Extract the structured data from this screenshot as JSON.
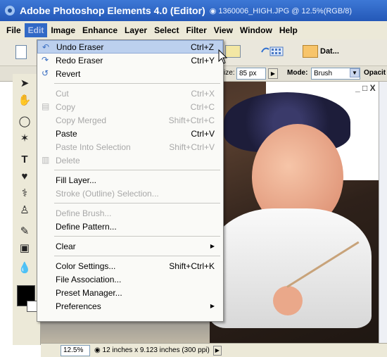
{
  "titlebar": {
    "app_title": "Adobe Photoshop Elements 4.0 (Editor)",
    "document_title": "◉ 1360006_HIGH.JPG @ 12.5%(RGB/8)"
  },
  "menubar": {
    "items": [
      "File",
      "Edit",
      "Image",
      "Enhance",
      "Layer",
      "Select",
      "Filter",
      "View",
      "Window",
      "Help"
    ],
    "active": "Edit"
  },
  "toolbar": {
    "date_view_label": "Dat..."
  },
  "options": {
    "size_label": "ize:",
    "size_value": "85 px",
    "mode_label": "Mode:",
    "mode_value": "Brush",
    "opacity_label": "Opacit"
  },
  "doc_controls": "_ □ X",
  "status": {
    "zoom": "12.5%",
    "doc_info": "◉ 12 inches x 9.123 inches (300 ppi)"
  },
  "edit_menu": {
    "items": [
      {
        "label": "Undo Eraser",
        "shortcut": "Ctrl+Z",
        "icon": "undo-icon",
        "enabled": true,
        "highlight": true
      },
      {
        "label": "Redo Eraser",
        "shortcut": "Ctrl+Y",
        "icon": "redo-icon",
        "enabled": true
      },
      {
        "label": "Revert",
        "shortcut": "",
        "icon": "revert-icon",
        "enabled": true
      },
      {
        "label": "Cut",
        "shortcut": "Ctrl+X",
        "icon": "",
        "enabled": false
      },
      {
        "label": "Copy",
        "shortcut": "Ctrl+C",
        "icon": "copy-icon",
        "enabled": false
      },
      {
        "label": "Copy Merged",
        "shortcut": "Shift+Ctrl+C",
        "icon": "",
        "enabled": false
      },
      {
        "label": "Paste",
        "shortcut": "Ctrl+V",
        "icon": "",
        "enabled": true
      },
      {
        "label": "Paste Into Selection",
        "shortcut": "Shift+Ctrl+V",
        "icon": "",
        "enabled": false
      },
      {
        "label": "Delete",
        "shortcut": "",
        "icon": "delete-icon",
        "enabled": false
      },
      {
        "label": "Fill Layer...",
        "shortcut": "",
        "icon": "",
        "enabled": true
      },
      {
        "label": "Stroke (Outline) Selection...",
        "shortcut": "",
        "icon": "",
        "enabled": false
      },
      {
        "label": "Define Brush...",
        "shortcut": "",
        "icon": "",
        "enabled": false
      },
      {
        "label": "Define Pattern...",
        "shortcut": "",
        "icon": "",
        "enabled": true
      },
      {
        "label": "Clear",
        "shortcut": "",
        "icon": "",
        "enabled": true,
        "submenu": true
      },
      {
        "label": "Color Settings...",
        "shortcut": "Shift+Ctrl+K",
        "icon": "",
        "enabled": true
      },
      {
        "label": "File Association...",
        "shortcut": "",
        "icon": "",
        "enabled": true
      },
      {
        "label": "Preset Manager...",
        "shortcut": "",
        "icon": "",
        "enabled": true
      },
      {
        "label": "Preferences",
        "shortcut": "",
        "icon": "",
        "enabled": true,
        "submenu": true
      }
    ]
  }
}
